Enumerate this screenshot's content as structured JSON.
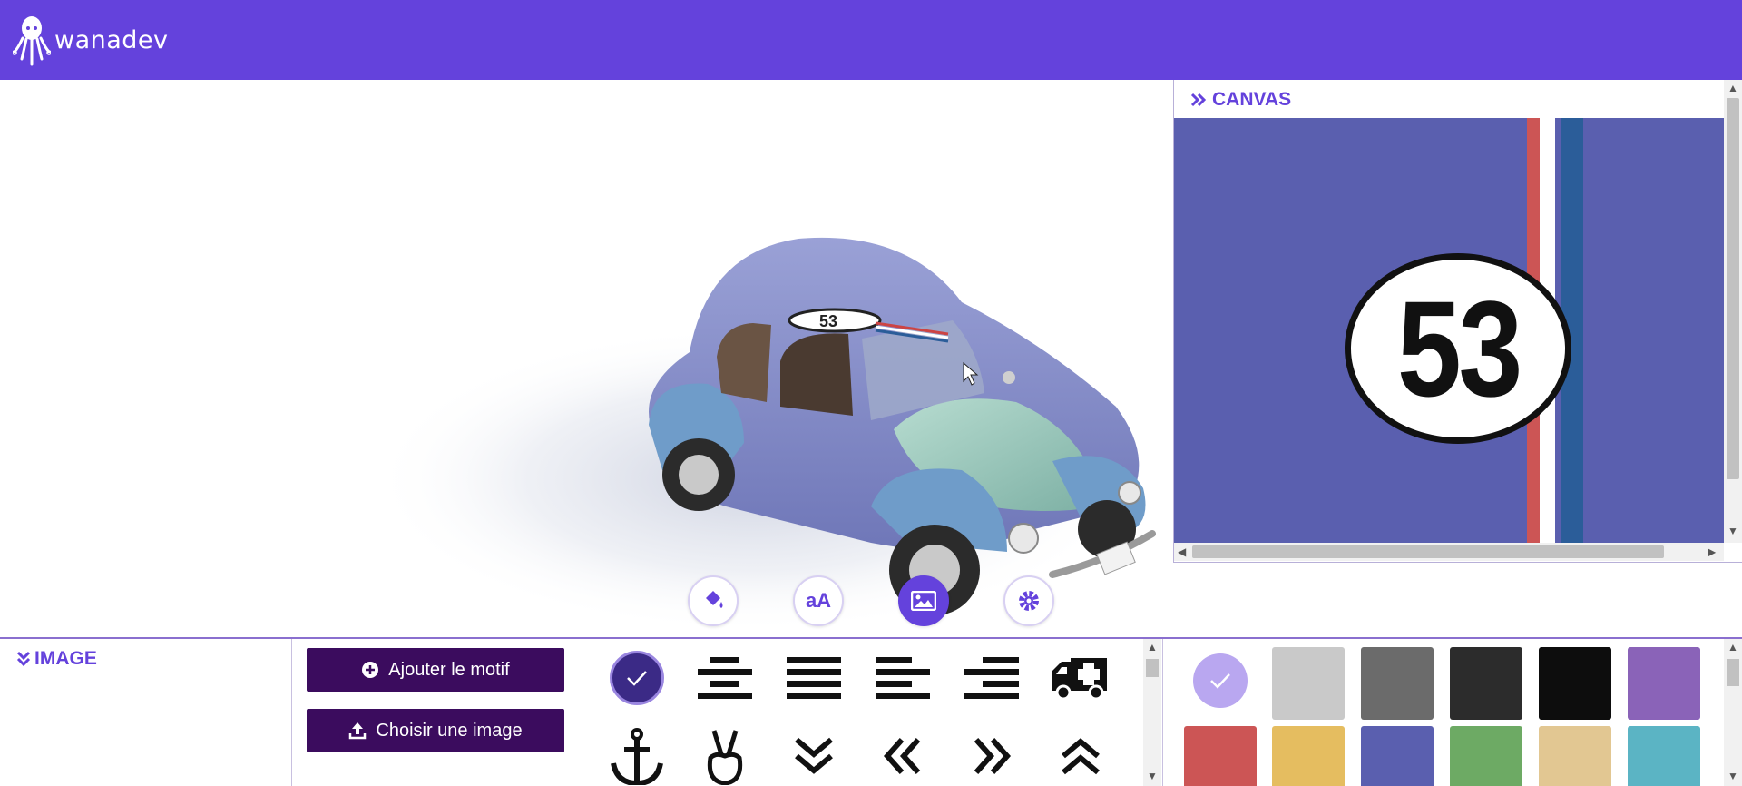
{
  "app": {
    "brand": "wanadev"
  },
  "tools": [
    {
      "name": "paint-bucket",
      "label": ""
    },
    {
      "name": "text",
      "label": "aA"
    },
    {
      "name": "image",
      "label": ""
    },
    {
      "name": "settings",
      "label": ""
    }
  ],
  "canvas_panel": {
    "title": "CANVAS",
    "race_number": "53"
  },
  "image_panel": {
    "title": "IMAGE",
    "add_motif_label": "Ajouter le motif",
    "choose_image_label": "Choisir une image"
  },
  "motifs": [
    "selected-check",
    "align-center",
    "align-justify",
    "align-left",
    "align-right",
    "ambulance",
    "anchor",
    "peace-hand",
    "double-chevron-down",
    "double-chevron-left",
    "double-chevron-right",
    "double-chevron-up"
  ],
  "colors": {
    "brand": "#6442DC",
    "button_dark": "#3B0C5E",
    "canvas_bg": "#5A5FAF",
    "swatches": [
      "#B9A7F0",
      "#C9C9C9",
      "#6B6B6B",
      "#2C2C2C",
      "#0D0D0D",
      "#8A63B8",
      "#CC5555",
      "#E5BD60",
      "#5A5FAF",
      "#6DAA64",
      "#E2C792",
      "#5BB4C4"
    ]
  }
}
